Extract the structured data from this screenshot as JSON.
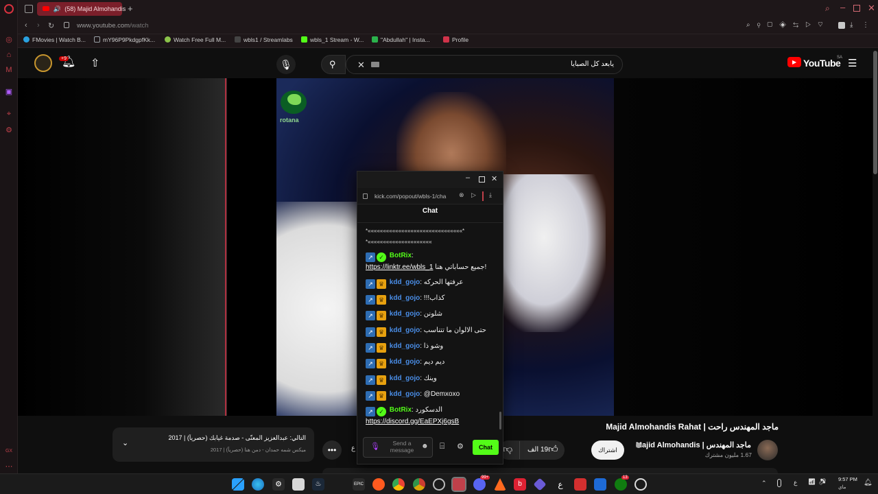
{
  "browser": {
    "tab_title": "(58) Majid Almohandis",
    "url_domain": "www.youtube.com",
    "url_path": "/watch",
    "bookmarks": [
      {
        "label": "FMovies | Watch B...",
        "color": "#2aa1e0"
      },
      {
        "label": "mY96P9PkdgpfKk...",
        "color": "#9aa0a6"
      },
      {
        "label": "Watch Free Full M...",
        "color": "#8bc34a"
      },
      {
        "label": "wbls1 / Streamlabs",
        "color": "#444444"
      },
      {
        "label": "wbls_1 Stream - W...",
        "color": "#53fc18"
      },
      {
        "label": "\"Abdullah\" | Insta...",
        "color": "#2bb24c"
      },
      {
        "label": "Profile",
        "color": "#d0334a"
      }
    ],
    "sidebar_badge": "GX"
  },
  "youtube": {
    "logo_text": "YouTube",
    "region": "SA",
    "notification_count": "+9",
    "search_value": "يابعد كل الصبايا",
    "video_title": "ماجد المهندس راحت | Majid Almohandis Rahat",
    "channel_name": "ماجد المهندس | Majid Almohandis",
    "subscribers": "1.67 مليون مشترك",
    "subscribe_label": "اشتراك",
    "likes": "19 الف",
    "next_title": "التالي: عبدالعزيز المعنّى - صدمة غيابك (حصرياً) | 2017",
    "next_subtitle": "ميكس شمه حمدان - دمن هنا (حصرياً) | 2017",
    "video_logo_text": "rotana"
  },
  "popup": {
    "url": "kick.com/popout/wbls-1/cha",
    "header": "Chat",
    "spam_line1": "*«««««««««««««««««««««««««««««««*",
    "spam_line2": "*«««««««««««««««««««««",
    "messages": [
      {
        "user": "BotRix",
        "type": "bot",
        "text": "جميع حساباتي هنا!",
        "link": "https://linktr.ee/wbls_1"
      },
      {
        "user": "kdd_gojo",
        "type": "sub",
        "text": "عرفتها الحركه"
      },
      {
        "user": "kdd_gojo",
        "type": "sub",
        "text": "!!!كذاب"
      },
      {
        "user": "kdd_gojo",
        "type": "sub",
        "text": "شلونن"
      },
      {
        "user": "kdd_gojo",
        "type": "sub",
        "text": "حتى الالوان ما تتناسب"
      },
      {
        "user": "kdd_gojo",
        "type": "sub",
        "text": "وشو ذا"
      },
      {
        "user": "kdd_gojo",
        "type": "sub",
        "text": "ديم ديم"
      },
      {
        "user": "kdd_gojo",
        "type": "sub",
        "text": "وينك"
      },
      {
        "user": "kdd_gojo",
        "type": "sub",
        "text": "@Demxoxo"
      },
      {
        "user": "BotRix",
        "type": "bot",
        "text": "الدسكورد",
        "link": "https://discord.gg/EaEPXj6gsB"
      }
    ],
    "send_placeholder": "Send a message",
    "chat_button": "Chat"
  },
  "taskbar": {
    "language": "ع",
    "time": "9:57 PM",
    "date": "ماي",
    "edge_badge": "99+",
    "xbox_badge": "13"
  },
  "colors": {
    "opera_red": "#c0404a",
    "kick_green": "#53fc18",
    "yt_red": "#ff0000",
    "accent_blue": "#4a8ee8"
  }
}
